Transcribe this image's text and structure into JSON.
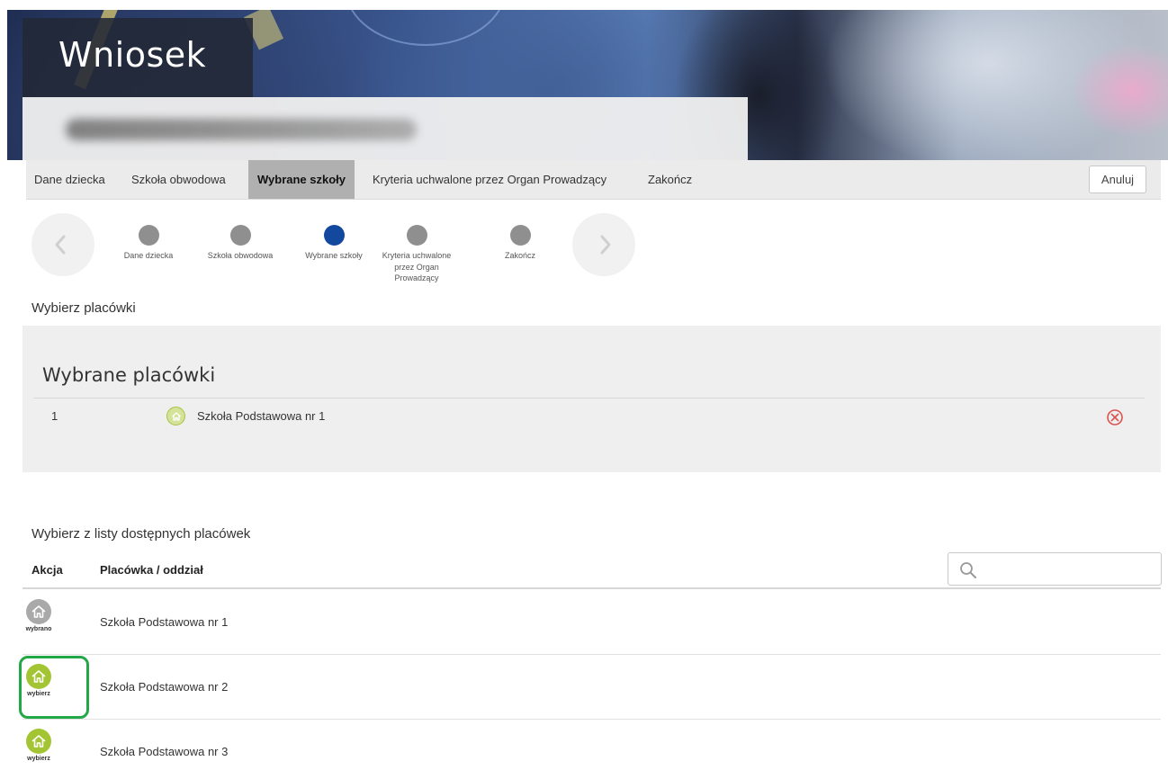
{
  "header": {
    "title": "Wniosek"
  },
  "nav": {
    "items": [
      {
        "label": "Dane dziecka"
      },
      {
        "label": "Szkoła obwodowa"
      },
      {
        "label": "Wybrane szkoły"
      },
      {
        "label": "Kryteria uchwalone przez Organ Prowadzący"
      },
      {
        "label": "Zakończ"
      }
    ],
    "cancel_label": "Anuluj"
  },
  "stepper": {
    "steps": [
      {
        "label": "Dane dziecka",
        "active": false
      },
      {
        "label": "Szkoła obwodowa",
        "active": false
      },
      {
        "label": "Wybrane szkoły",
        "active": true
      },
      {
        "label": "Kryteria uchwalone przez Organ Prowadzący",
        "active": false
      },
      {
        "label": "Zakończ",
        "active": false
      }
    ]
  },
  "select_section": {
    "title": "Wybierz placówki"
  },
  "selected": {
    "heading": "Wybrane placówki",
    "items": [
      {
        "index": "1",
        "name": "Szkoła Podstawowa nr 1"
      }
    ]
  },
  "available": {
    "title": "Wybierz z listy dostępnych placówek",
    "columns": {
      "action": "Akcja",
      "name": "Placówka / oddział"
    },
    "search": {
      "value": "",
      "placeholder": ""
    },
    "rows": [
      {
        "name": "Szkoła Podstawowa nr 1",
        "action_label": "wybrano"
      },
      {
        "name": "Szkoła Podstawowa nr 2",
        "action_label": "wybierz"
      },
      {
        "name": "Szkoła Podstawowa nr 3",
        "action_label": "wybierz"
      }
    ]
  },
  "colors": {
    "accent": "#12499e",
    "nav_active": "#b0b0b0",
    "action_green": "#a4c533",
    "action_grey": "#a9a9a9",
    "remove_red": "#d9534f",
    "highlight": "#22a846"
  },
  "icons": {
    "prev": "chevron-left-icon",
    "next": "chevron-right-icon",
    "search": "search-icon",
    "remove": "close-circle-icon",
    "school": "house-icon"
  }
}
